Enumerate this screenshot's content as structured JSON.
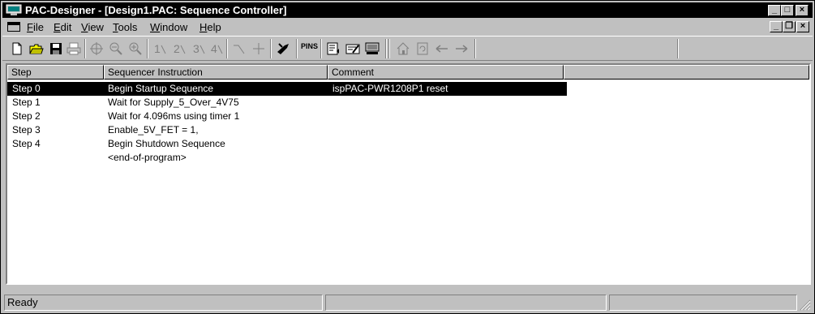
{
  "window": {
    "title": "PAC-Designer - [Design1.PAC: Sequence Controller]",
    "caption_buttons": {
      "minimize": "_",
      "maximize": "□",
      "close": "×"
    }
  },
  "menubar": {
    "items": [
      {
        "label": "File",
        "accel": "F",
        "rest": "ile"
      },
      {
        "label": "Edit",
        "accel": "E",
        "rest": "dit"
      },
      {
        "label": "View",
        "accel": "V",
        "rest": "iew"
      },
      {
        "label": "Tools",
        "accel": "T",
        "rest": "ools"
      },
      {
        "label": "Window",
        "accel": "W",
        "rest": "indow"
      },
      {
        "label": "Help",
        "accel": "H",
        "rest": "elp"
      }
    ],
    "mdi_buttons": {
      "minimize": "_",
      "restore": "❐",
      "close": "×"
    }
  },
  "toolbar": {
    "icons": [
      "new-file-icon",
      "open-folder-icon",
      "save-icon",
      "print-icon",
      "zoom-fit-icon",
      "zoom-out-icon",
      "zoom-in-icon",
      "step1-icon",
      "step2-icon",
      "step3-icon",
      "step4-icon",
      "wire-icon",
      "crosshair-icon",
      "compile-icon",
      "pins-icon",
      "report-icon",
      "edit-icon",
      "program-icon",
      "home-icon",
      "refresh-icon",
      "back-arrow-icon",
      "forward-arrow-icon"
    ],
    "pins_label": "PINS"
  },
  "list": {
    "columns": [
      "Step",
      "Sequencer Instruction",
      "Comment",
      ""
    ],
    "rows": [
      {
        "step": "Step 0",
        "instruction": "Begin Startup Sequence",
        "comment": "ispPAC-PWR1208P1  reset",
        "selected": true
      },
      {
        "step": "Step 1",
        "instruction": "Wait for  Supply_5_Over_4V75",
        "comment": "",
        "selected": false
      },
      {
        "step": "Step 2",
        "instruction": "Wait for 4.096ms using timer 1",
        "comment": "",
        "selected": false
      },
      {
        "step": "Step 3",
        "instruction": "Enable_5V_FET = 1,",
        "comment": "",
        "selected": false
      },
      {
        "step": "Step 4",
        "instruction": "Begin Shutdown Sequence",
        "comment": "",
        "selected": false
      },
      {
        "step": "",
        "instruction": "<end-of-program>",
        "comment": "",
        "selected": false
      }
    ]
  },
  "status": {
    "text": "Ready"
  },
  "colors": {
    "titlebar": "#000000",
    "face": "#c0c0c0",
    "selection": "#000000",
    "window": "#ffffff"
  }
}
